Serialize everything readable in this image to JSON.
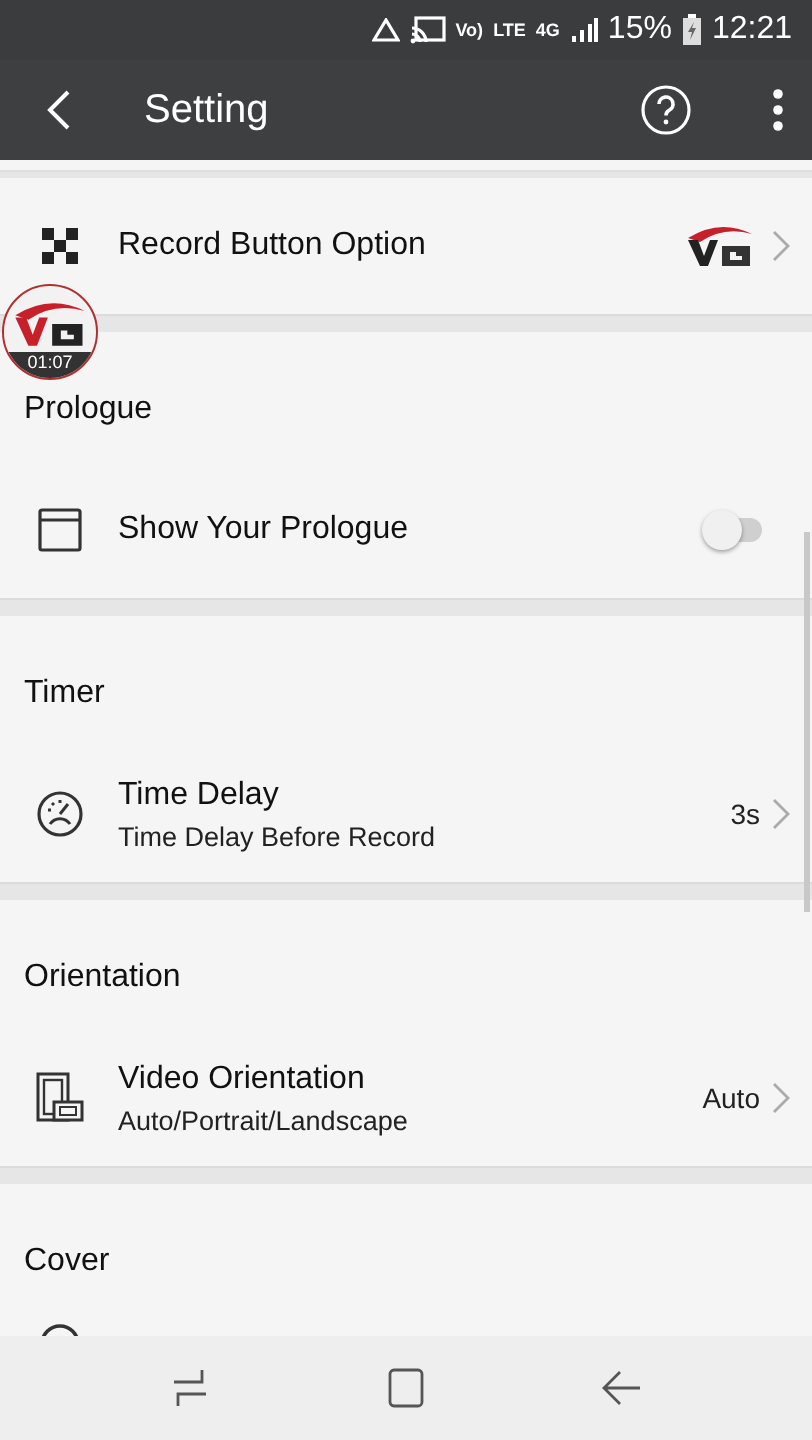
{
  "status_bar": {
    "indicators": [
      "Vo)",
      "LTE",
      "4G"
    ],
    "battery": "15%",
    "time": "12:21"
  },
  "toolbar": {
    "title": "Setting"
  },
  "overlay": {
    "timer": "01:07"
  },
  "sections": [
    {
      "rows": [
        {
          "kind": "logo-link",
          "title": "Record Button Option"
        }
      ]
    },
    {
      "header": "Prologue",
      "rows": [
        {
          "kind": "toggle",
          "title": "Show Your Prologue",
          "on": false
        }
      ]
    },
    {
      "header": "Timer",
      "rows": [
        {
          "kind": "link",
          "title": "Time Delay",
          "subtitle": "Time Delay Before Record",
          "value": "3s"
        }
      ]
    },
    {
      "header": "Orientation",
      "rows": [
        {
          "kind": "link",
          "title": "Video Orientation",
          "subtitle": "Auto/Portrait/Landscape",
          "value": "Auto"
        }
      ]
    },
    {
      "header": "Cover",
      "rows": [
        {
          "kind": "cut"
        }
      ]
    }
  ]
}
